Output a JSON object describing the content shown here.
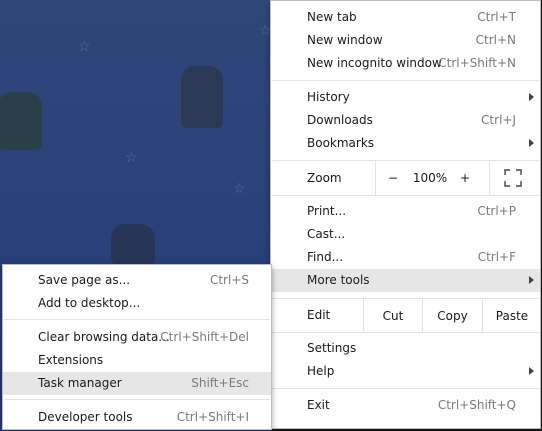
{
  "main_menu": {
    "new_tab": {
      "label": "New tab",
      "shortcut": "Ctrl+T"
    },
    "new_window": {
      "label": "New window",
      "shortcut": "Ctrl+N"
    },
    "new_incognito": {
      "label": "New incognito window",
      "shortcut": "Ctrl+Shift+N"
    },
    "history": {
      "label": "History"
    },
    "downloads": {
      "label": "Downloads",
      "shortcut": "Ctrl+J"
    },
    "bookmarks": {
      "label": "Bookmarks"
    },
    "zoom": {
      "label": "Zoom",
      "minus": "−",
      "level": "100%",
      "plus": "+",
      "fullscreen_icon": "fullscreen-icon"
    },
    "print": {
      "label": "Print...",
      "shortcut": "Ctrl+P"
    },
    "cast": {
      "label": "Cast..."
    },
    "find": {
      "label": "Find...",
      "shortcut": "Ctrl+F"
    },
    "more_tools": {
      "label": "More tools"
    },
    "edit": {
      "label": "Edit",
      "cut": "Cut",
      "copy": "Copy",
      "paste": "Paste"
    },
    "settings": {
      "label": "Settings"
    },
    "help": {
      "label": "Help"
    },
    "exit": {
      "label": "Exit",
      "shortcut": "Ctrl+Shift+Q"
    }
  },
  "more_tools_menu": {
    "save_page": {
      "label": "Save page as...",
      "shortcut": "Ctrl+S"
    },
    "add_to_desktop": {
      "label": "Add to desktop..."
    },
    "clear_browsing": {
      "label": "Clear browsing data...",
      "shortcut": "Ctrl+Shift+Del"
    },
    "extensions": {
      "label": "Extensions"
    },
    "task_manager": {
      "label": "Task manager",
      "shortcut": "Shift+Esc"
    },
    "developer_tools": {
      "label": "Developer tools",
      "shortcut": "Ctrl+Shift+I"
    }
  },
  "colors": {
    "highlight": "#e6e6e6",
    "background_page": "#2c427a",
    "shortcut_text": "#7a7a7a"
  }
}
